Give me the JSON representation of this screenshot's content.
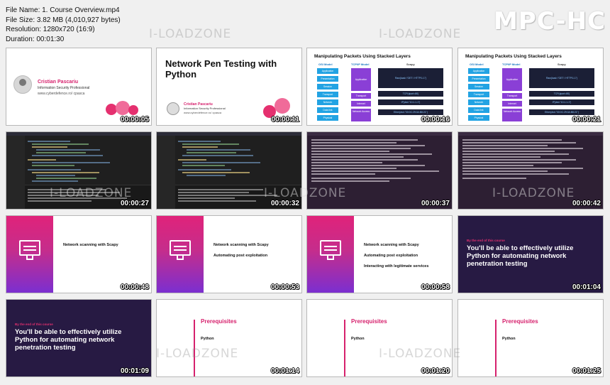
{
  "info": {
    "file_name": "File Name: 1. Course Overview.mp4",
    "file_size": "File Size: 3.82 MB (4,010,927 bytes)",
    "resolution": "Resolution: 1280x720 (16:9)",
    "duration": "Duration: 00:01:30"
  },
  "brand": "MPC-HC",
  "watermark": "I-LOADZONE",
  "author": {
    "name": "Cristian Pascariu",
    "role": "Information Security Professional",
    "handle": "www.cyberdefence.ro/  cpasca"
  },
  "course_title": "Network Pen Testing with Python",
  "layers": {
    "title": "Manipulating Packets Using Stacked Layers",
    "osi_header": "OSI Model",
    "tcp_header": "TCP/IP Model",
    "scapy_header": "Scapy",
    "osi": [
      "Application",
      "Presentation",
      "Session",
      "Transport",
      "Network",
      "Data link",
      "Physical"
    ],
    "tcp": [
      "Application",
      "Transport",
      "Internet",
      "Network Access"
    ],
    "scapy": [
      "Raw(load=\"GET / HTTP/1.1\")",
      "TCP(dport=80)",
      "IP(dst=\"10.1.1.1\")",
      "Ether(dst=\"00:0C:29:0A:B8:21\")"
    ]
  },
  "features": [
    "Network scanning with Scapy",
    "Automating post exploitation",
    "Interacting with legitimate services"
  ],
  "goal": {
    "tag": "By the end of this course",
    "text": "You'll be able to effectively utilize Python for automating network penetration testing"
  },
  "prereq": {
    "heading": "Prerequisites",
    "item": "Python"
  },
  "timestamps": [
    "00:00:05",
    "00:00:11",
    "00:00:16",
    "00:00:21",
    "00:00:27",
    "00:00:32",
    "00:00:37",
    "00:00:42",
    "00:00:48",
    "00:00:53",
    "00:00:58",
    "00:01:04",
    "00:01:09",
    "00:01:14",
    "00:01:20",
    "00:01:25"
  ]
}
